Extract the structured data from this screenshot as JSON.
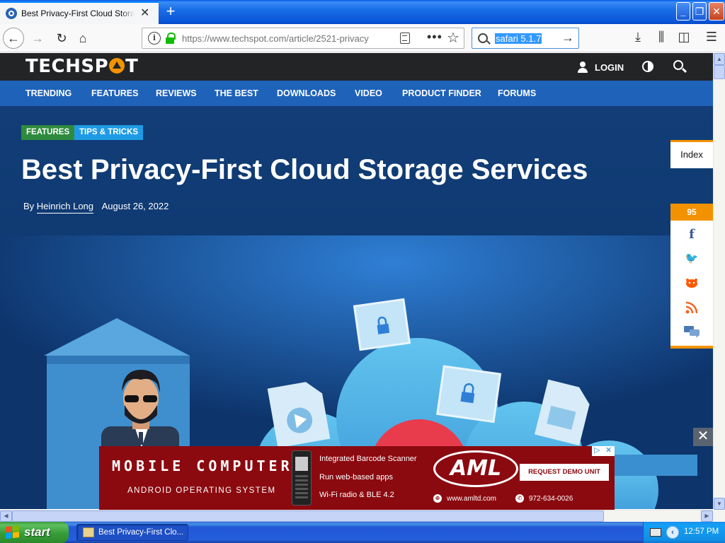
{
  "browser": {
    "tab": {
      "title": "Best Privacy-First Cloud Storage Services"
    },
    "url": "https://www.techspot.com/article/2521-privacy",
    "search_query": "safari 5.1.7"
  },
  "site": {
    "logo": {
      "left": "TECHSP",
      "right": "T"
    },
    "login_label": "LOGIN",
    "nav": [
      "TRENDING",
      "FEATURES",
      "REVIEWS",
      "THE BEST",
      "DOWNLOADS",
      "VIDEO",
      "PRODUCT FINDER",
      "FORUMS"
    ]
  },
  "article": {
    "tags": [
      "FEATURES",
      "TIPS & TRICKS"
    ],
    "title": "Best Privacy-First Cloud Storage Services",
    "by_label": "By",
    "author": "Heinrich Long",
    "date": "August 26, 2022"
  },
  "sidebar": {
    "index_label": "Index",
    "share_count": "95",
    "share_icons": [
      "facebook-icon",
      "twitter-icon",
      "reddit-icon",
      "rss-icon",
      "comments-icon"
    ]
  },
  "ad": {
    "title": "MOBILE COMPUTER",
    "subtitle": "ANDROID OPERATING SYSTEM",
    "features": [
      "Integrated Barcode Scanner",
      "Run web-based apps",
      "Wi-Fi radio & BLE 4.2"
    ],
    "logo": "AML",
    "cta": "REQUEST DEMO UNIT",
    "website": "www.amltd.com",
    "phone": "972-634-0026"
  },
  "taskbar": {
    "start_label": "start",
    "window_label": "Best Privacy-First Clo...",
    "clock": "12:57 PM"
  },
  "colors": {
    "site_header": "#222426",
    "nav_blue": "#1f62b9",
    "accent_orange": "#f29200",
    "tag_green": "#2e8b3e",
    "tag_blue": "#1f9be6",
    "ad_red": "#8b0a10"
  }
}
